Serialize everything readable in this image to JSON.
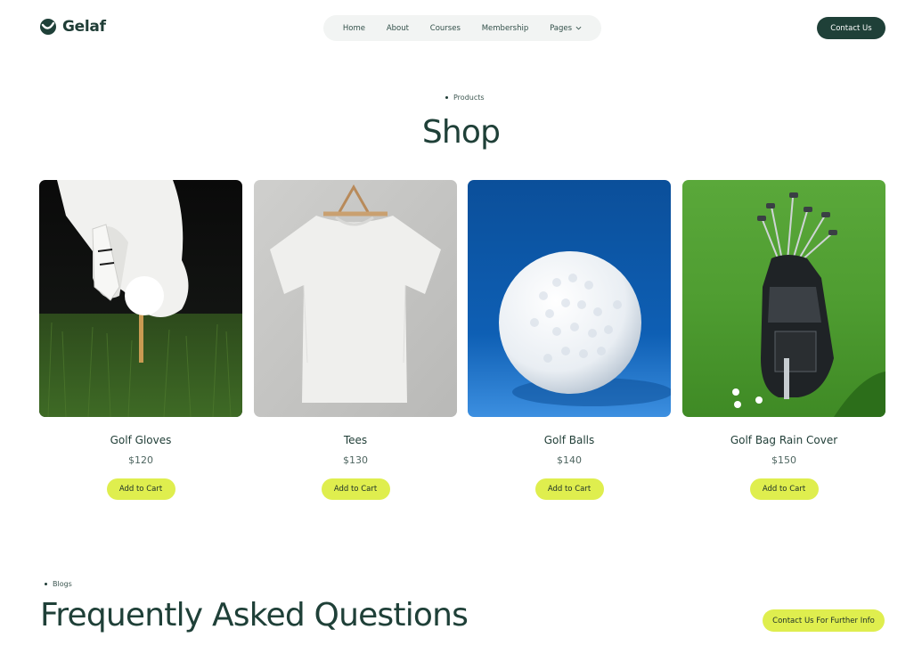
{
  "brand": {
    "name": "Gelaf"
  },
  "nav": {
    "items": [
      {
        "label": "Home"
      },
      {
        "label": "About"
      },
      {
        "label": "Courses"
      },
      {
        "label": "Membership"
      },
      {
        "label": "Pages",
        "icon": "chevron-down-icon"
      }
    ]
  },
  "header": {
    "contact_label": "Contact Us"
  },
  "shop": {
    "eyebrow": "Products",
    "title": "Shop",
    "products": [
      {
        "name": "Golf Gloves",
        "price": "$120",
        "cta": "Add to Cart"
      },
      {
        "name": "Tees",
        "price": "$130",
        "cta": "Add to Cart"
      },
      {
        "name": "Golf Balls",
        "price": "$140",
        "cta": "Add to Cart"
      },
      {
        "name": "Golf Bag Rain Cover",
        "price": "$150",
        "cta": "Add to Cart"
      }
    ]
  },
  "faq": {
    "eyebrow": "Blogs",
    "title": "Frequently Asked Questions",
    "cta": "Contact Us For Further Info"
  },
  "colors": {
    "brand_dark": "#1f4038",
    "accent_lime": "#dfee4e",
    "nav_bg": "#f2f4f3"
  }
}
